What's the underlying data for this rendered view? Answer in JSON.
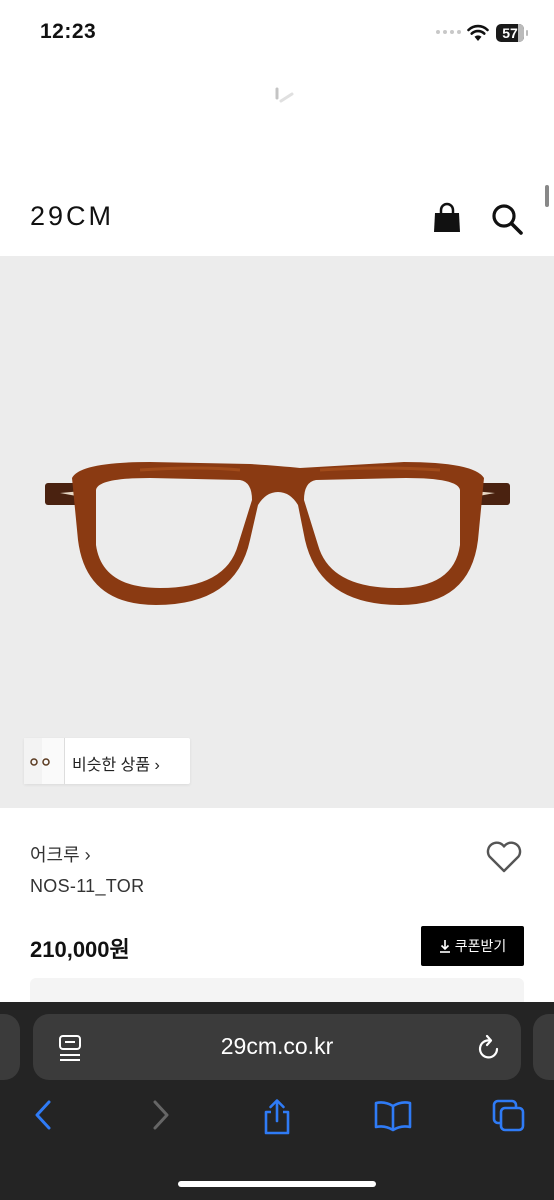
{
  "status": {
    "time": "12:23",
    "battery": "57"
  },
  "header": {
    "logo": "29CM"
  },
  "hero": {
    "similar_label": "비슷한 상품 ›"
  },
  "product": {
    "brand": "어크루 ›",
    "name": "NOS-11_TOR",
    "price": "210,000원",
    "coupon_label": "쿠폰받기"
  },
  "safari": {
    "url": "29cm.co.kr"
  },
  "colors": {
    "hero_bg": "#ececec",
    "frame": "#8a3a12",
    "safari_bg": "#242424",
    "link_blue": "#2f7bf6"
  }
}
